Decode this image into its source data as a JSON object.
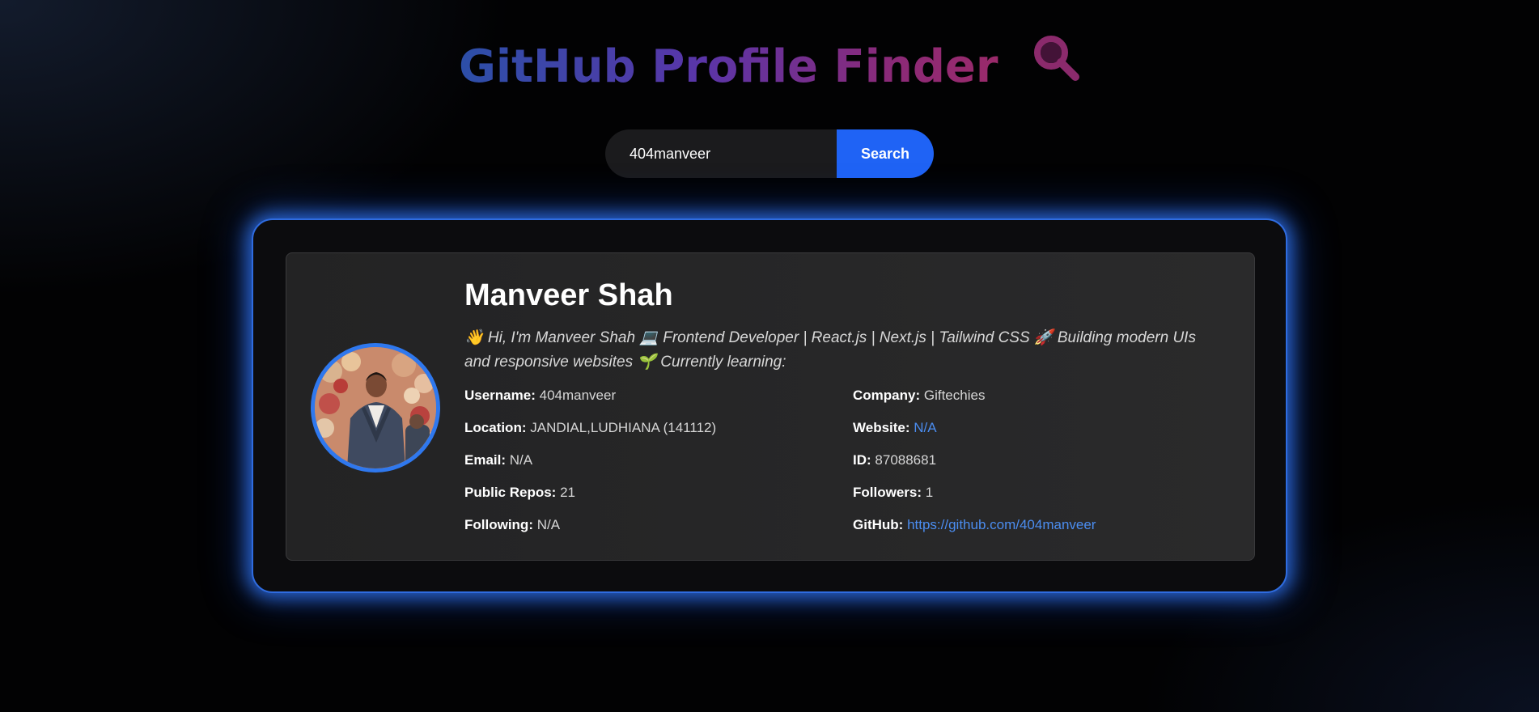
{
  "header": {
    "title": "GitHub Profile Finder",
    "icon": "magnifier-icon",
    "gradient_colors": [
      "#2c4fa8",
      "#5a35a8",
      "#9a2a6a"
    ]
  },
  "search": {
    "value": "404manveer",
    "button_label": "Search",
    "accent_color": "#1f63f5"
  },
  "profile": {
    "name": "Manveer Shah",
    "bio": "👋 Hi, I'm Manveer Shah 💻 Frontend Developer | React.js | Next.js | Tailwind CSS 🚀 Building modern UIs and responsive websites 🌱 Currently learning:",
    "avatar_icon": "avatar-photo",
    "username": {
      "label": "Username:",
      "value": "404manveer"
    },
    "company": {
      "label": "Company:",
      "value": "Giftechies"
    },
    "location": {
      "label": "Location:",
      "value": "JANDIAL,LUDHIANA (141112)"
    },
    "website": {
      "label": "Website:",
      "value": "N/A"
    },
    "email": {
      "label": "Email:",
      "value": "N/A"
    },
    "id": {
      "label": "ID:",
      "value": "87088681"
    },
    "public_repos": {
      "label": "Public Repos:",
      "value": "21"
    },
    "followers": {
      "label": "Followers:",
      "value": "1"
    },
    "following": {
      "label": "Following:",
      "value": "N/A"
    },
    "github": {
      "label": "GitHub:",
      "value": "https://github.com/404manveer"
    }
  }
}
